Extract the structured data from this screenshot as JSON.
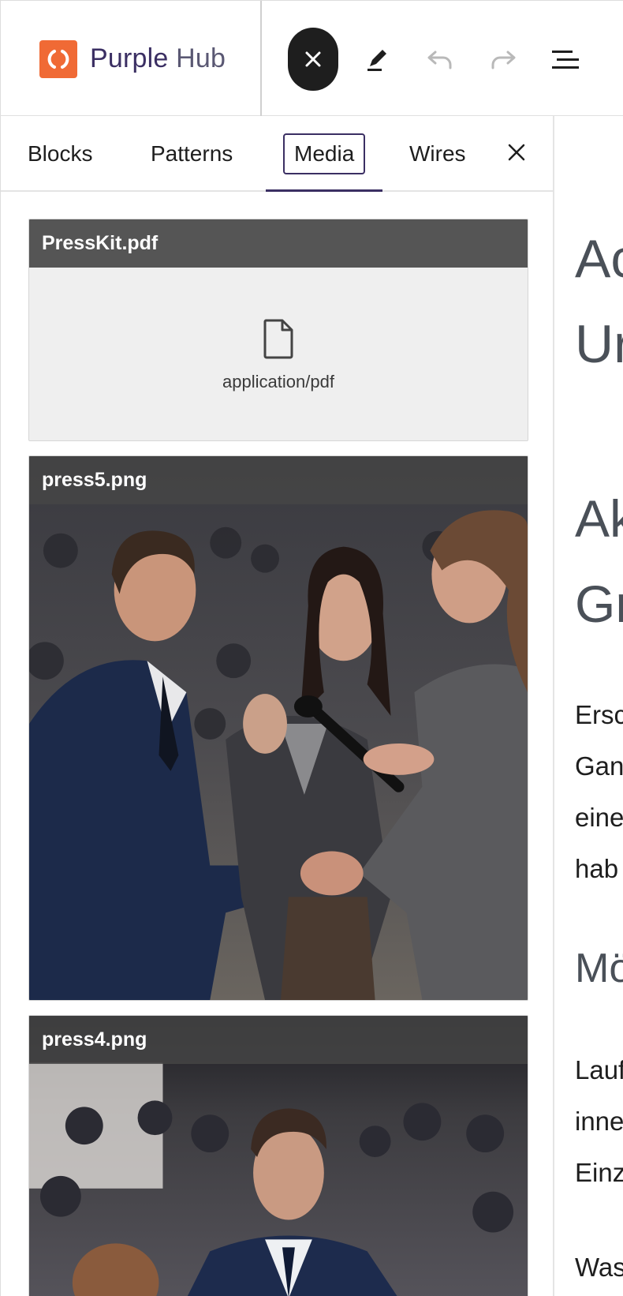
{
  "brand": {
    "name_part1": "Purple",
    "name_part2": "Hub"
  },
  "toolbar": {
    "close_icon": "close-icon",
    "edit_icon": "pencil-icon",
    "undo_icon": "undo-icon",
    "redo_icon": "redo-icon",
    "outline_icon": "list-view-icon"
  },
  "sidebar": {
    "tabs": [
      {
        "label": "Blocks"
      },
      {
        "label": "Patterns"
      },
      {
        "label": "Media",
        "active": true
      },
      {
        "label": "Wires"
      }
    ],
    "media": [
      {
        "title": "PressKit.pdf",
        "mime": "application/pdf",
        "icon": "file-icon"
      },
      {
        "title": "press5.png",
        "icon": "image"
      },
      {
        "title": "press4.png",
        "icon": "image"
      }
    ]
  },
  "canvas": {
    "heading1": [
      "Ac",
      "Ur"
    ],
    "heading2": [
      "Ak",
      "Gr"
    ],
    "para1": [
      "Ersc",
      "Gan",
      "eine",
      "hab"
    ],
    "heading3": "Mö",
    "para2": [
      "Lauf",
      "inne",
      "Einz"
    ],
    "para3": "Was"
  },
  "colors": {
    "accent": "#3b2f63",
    "logo": "#f06a35",
    "dark": "#1e1e1e"
  }
}
